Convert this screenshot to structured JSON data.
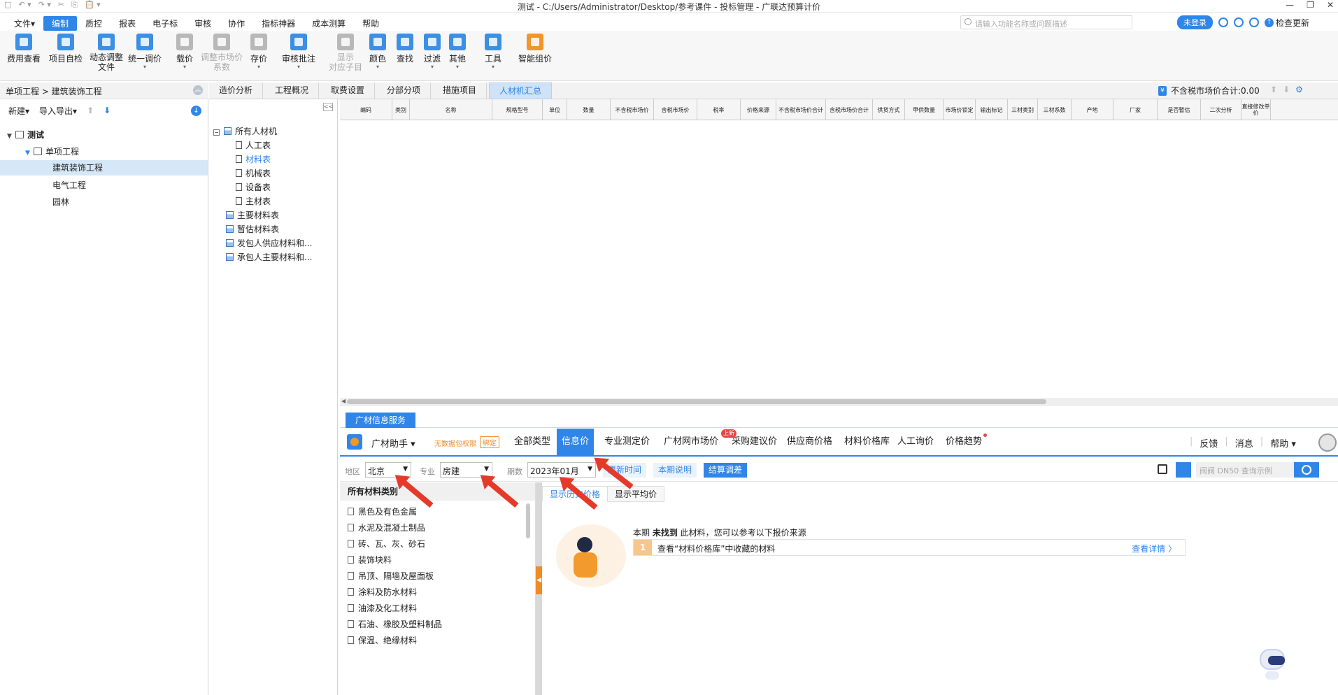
{
  "titlebar": {
    "title": "测试 - C:/Users/Administrator/Desktop/参考课件 - 投标管理 - 广联达预算计价",
    "quick_access": [
      "□",
      "↶ ▾",
      "↷ ▾",
      "✂",
      "⎘",
      "📋 ▾"
    ],
    "win_controls": [
      "—",
      "❐",
      "✕"
    ]
  },
  "menu": {
    "items": [
      "文件▾",
      "编制",
      "质控",
      "报表",
      "电子标",
      "审核",
      "协作",
      "指标神器",
      "成本测算",
      "帮助"
    ],
    "active_index": 1,
    "search_placeholder": "请输入功能名称或问题描述",
    "login": "未登录",
    "update": "检查更新"
  },
  "ribbon": {
    "buttons": [
      {
        "label": "费用查看",
        "caret": ""
      },
      {
        "label": "项目自检",
        "caret": ""
      },
      {
        "label": "动态调整\n文件",
        "caret": ""
      },
      {
        "label": "统一调价",
        "caret": "▾"
      },
      {
        "label": "载价",
        "caret": "▾"
      },
      {
        "label": "调整市场价\n系数",
        "caret": ""
      },
      {
        "label": "存价",
        "caret": "▾"
      },
      {
        "label": "审核批注",
        "caret": "▾"
      },
      {
        "label": "显示\n对应子目",
        "caret": ""
      },
      {
        "label": "颜色",
        "caret": "▾"
      },
      {
        "label": "查找",
        "caret": ""
      },
      {
        "label": "过滤",
        "caret": "▾"
      },
      {
        "label": "其他",
        "caret": "▾"
      },
      {
        "label": "工具",
        "caret": "▾"
      },
      {
        "label": "智能组价",
        "caret": ""
      }
    ]
  },
  "left": {
    "breadcrumb": "单项工程 > 建筑装饰工程",
    "new_label": "新建▾",
    "import_label": "导入导出▾",
    "tree": [
      {
        "label": "测试",
        "level": 0
      },
      {
        "label": "单项工程",
        "level": 1
      },
      {
        "label": "建筑装饰工程",
        "level": 2,
        "selected": true
      },
      {
        "label": "电气工程",
        "level": 2
      },
      {
        "label": "园林",
        "level": 2
      }
    ]
  },
  "tabs": {
    "items": [
      "造价分析",
      "工程概况",
      "取费设置",
      "分部分项",
      "措施项目",
      "人材机汇总"
    ],
    "active_index": 5,
    "tax_sum": "不含税市场价合计:0.00"
  },
  "mattree": {
    "root": "所有人材机",
    "children": [
      "人工表",
      "材料表",
      "机械表",
      "设备表",
      "主材表"
    ],
    "selected_child": 1,
    "others": [
      "主要材料表",
      "暂估材料表",
      "发包人供应材料和...",
      "承包人主要材料和..."
    ]
  },
  "grid": {
    "columns": [
      "编码",
      "类别",
      "名称",
      "规格型号",
      "单位",
      "数量",
      "不含税市场价",
      "含税市场价",
      "税率",
      "价格来源",
      "不含税市场价合计",
      "含税市场价合计",
      "供货方式",
      "甲供数量",
      "市场价锁定",
      "输出标记",
      "三材类别",
      "三材系数",
      "产地",
      "厂家",
      "是否暂估",
      "二次分析",
      "直接修改单价"
    ]
  },
  "service": {
    "tab": "广材信息服务",
    "assistant": "广材助手",
    "free_text": "无数据包权限",
    "free_btn": "绑定",
    "tabs": [
      "全部类型",
      "信息价",
      "专业测定价",
      "广材网市场价",
      "采购建议价",
      "供应商价格",
      "材料价格库",
      "人工询价",
      "价格趋势"
    ],
    "active_tab": 1,
    "new_badge": "上新",
    "right_links": [
      "反馈",
      "消息",
      "帮助 ▾"
    ]
  },
  "filter": {
    "region_label": "地区",
    "region": "北京",
    "major_label": "专业",
    "major": "房建",
    "period_label": "期数",
    "period": "2023年01月",
    "btn_update": "更新时间",
    "btn_note": "本期说明",
    "btn_settle": "结算调差",
    "search_placeholder": "阀阀 DN50 查询示例"
  },
  "categories": {
    "header": "所有材料类别",
    "items": [
      "黑色及有色金属",
      "水泥及混凝土制品",
      "砖、瓦、灰、砂石",
      "装饰块料",
      "吊顶、隔墙及屋面板",
      "涂料及防水材料",
      "油漆及化工材料",
      "石油、橡胶及塑料制品",
      "保温、绝缘材料"
    ]
  },
  "result": {
    "tabs": [
      "显示历史价格",
      "显示平均价"
    ],
    "msg_prefix": "本期 ",
    "msg_bold": "未找到",
    "msg_suffix": " 此材料，您可以参考以下报价来源",
    "option_num": "1",
    "option_text": "查看“材料价格库”中收藏的材料",
    "option_more": "查看详情 〉"
  },
  "colors": {
    "accent": "#2f86e8",
    "orange": "#f08a24",
    "arrow": "#e53a2a"
  }
}
